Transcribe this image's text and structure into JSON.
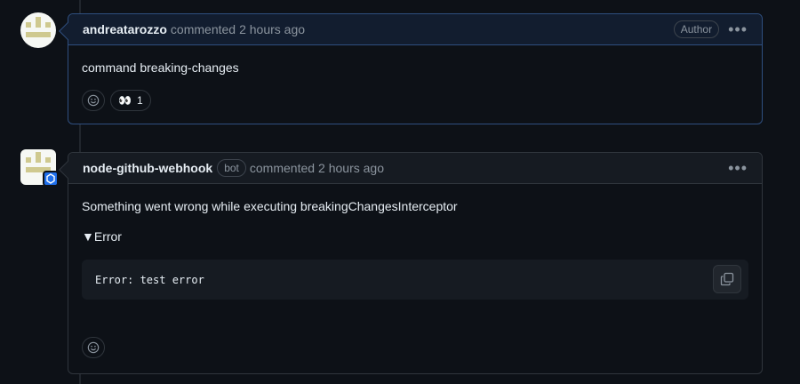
{
  "comments": [
    {
      "username": "andreatarozzo",
      "action": "commented",
      "time": "2 hours ago",
      "badge": "Author",
      "body": "command breaking-changes",
      "reactions": [
        {
          "emoji": "👀",
          "count": "1"
        }
      ]
    },
    {
      "username": "node-github-webhook",
      "bot_label": "bot",
      "action": "commented",
      "time": "2 hours ago",
      "body": "Something went wrong while executing breakingChangesInterceptor",
      "details_summary": "▼Error",
      "code": "Error: test error"
    }
  ],
  "icons": {
    "more": "kebab-horizontal-icon",
    "smiley": "smiley-icon",
    "copy": "copy-icon"
  },
  "colors": {
    "author_border": "#2f4f7f",
    "header_author_bg": "#121d2f",
    "bot_badge": "#1f6feb"
  }
}
